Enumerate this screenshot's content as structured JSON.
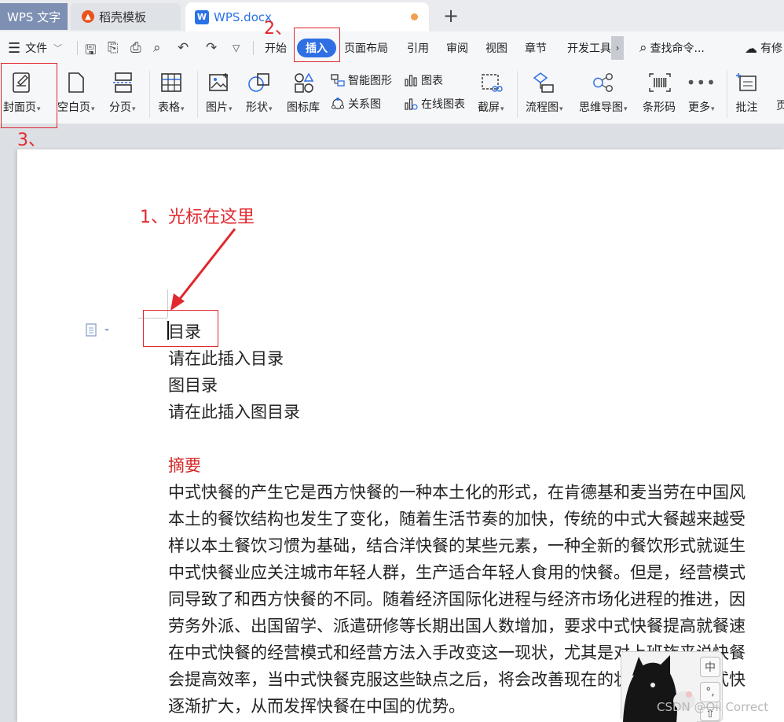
{
  "tabs": {
    "app": "WPS 文字",
    "template": "稻壳模板",
    "doc": "WPS.docx",
    "new_tab": "+"
  },
  "menu": {
    "file": "文件",
    "items": [
      "开始",
      "插入",
      "页面布局",
      "引用",
      "审阅",
      "视图",
      "章节",
      "开发工具"
    ],
    "search_placeholder": "查找命令...",
    "cloud": "有修"
  },
  "ribbon": {
    "cover": "封面页",
    "blank": "空白页",
    "page_break": "分页",
    "table": "表格",
    "picture": "图片",
    "shape": "形状",
    "icon_lib": "图标库",
    "smart_shape": "智能图形",
    "chart": "图表",
    "relation": "关系图",
    "online_chart": "在线图表",
    "screenshot": "截屏",
    "flowchart": "流程图",
    "mindmap": "思维导图",
    "barcode": "条形码",
    "more": "更多",
    "comment": "批注",
    "cut_label": "页"
  },
  "annotations": {
    "step1": "1、光标在这里",
    "step2": "2、",
    "step3": "3、"
  },
  "document": {
    "toc_title": "目录",
    "toc_placeholder": "请在此插入目录",
    "fig_toc_title": "图目录",
    "fig_toc_placeholder": "请在此插入图目录",
    "abstract_heading": "摘要",
    "body_lines": [
      "中式快餐的产生它是西方快餐的一种本土化的形式，在肯德基和麦当劳在中国风",
      "本土的餐饮结构也发生了变化，随着生活节奏的加快，传统的中式大餐越来越受",
      "样以本土餐饮习惯为基础，结合洋快餐的某些元素，一种全新的餐饮形式就诞生",
      "中式快餐业应关注城市年轻人群，生产适合年轻人食用的快餐。但是，经营模式",
      "同导致了和西方快餐的不同。随着经济国际化进程与经济市场化进程的推进，因",
      "劳务外派、出国留学、派遣研修等长期出国人数增加，要求中式快餐提高就餐速",
      "在中式快餐的经营模式和经营方法入手改变这一现状，尤其是对上班族来说快餐",
      "会提高效率，当中式快餐克服这些缺点之后，将会改善现在的状况，使得中式快",
      "逐渐扩大，从而发挥快餐在中国的优势。"
    ]
  },
  "ime": {
    "lang": "中",
    "punct": "°,"
  },
  "watermark": "CSDN @Oil Correct"
}
